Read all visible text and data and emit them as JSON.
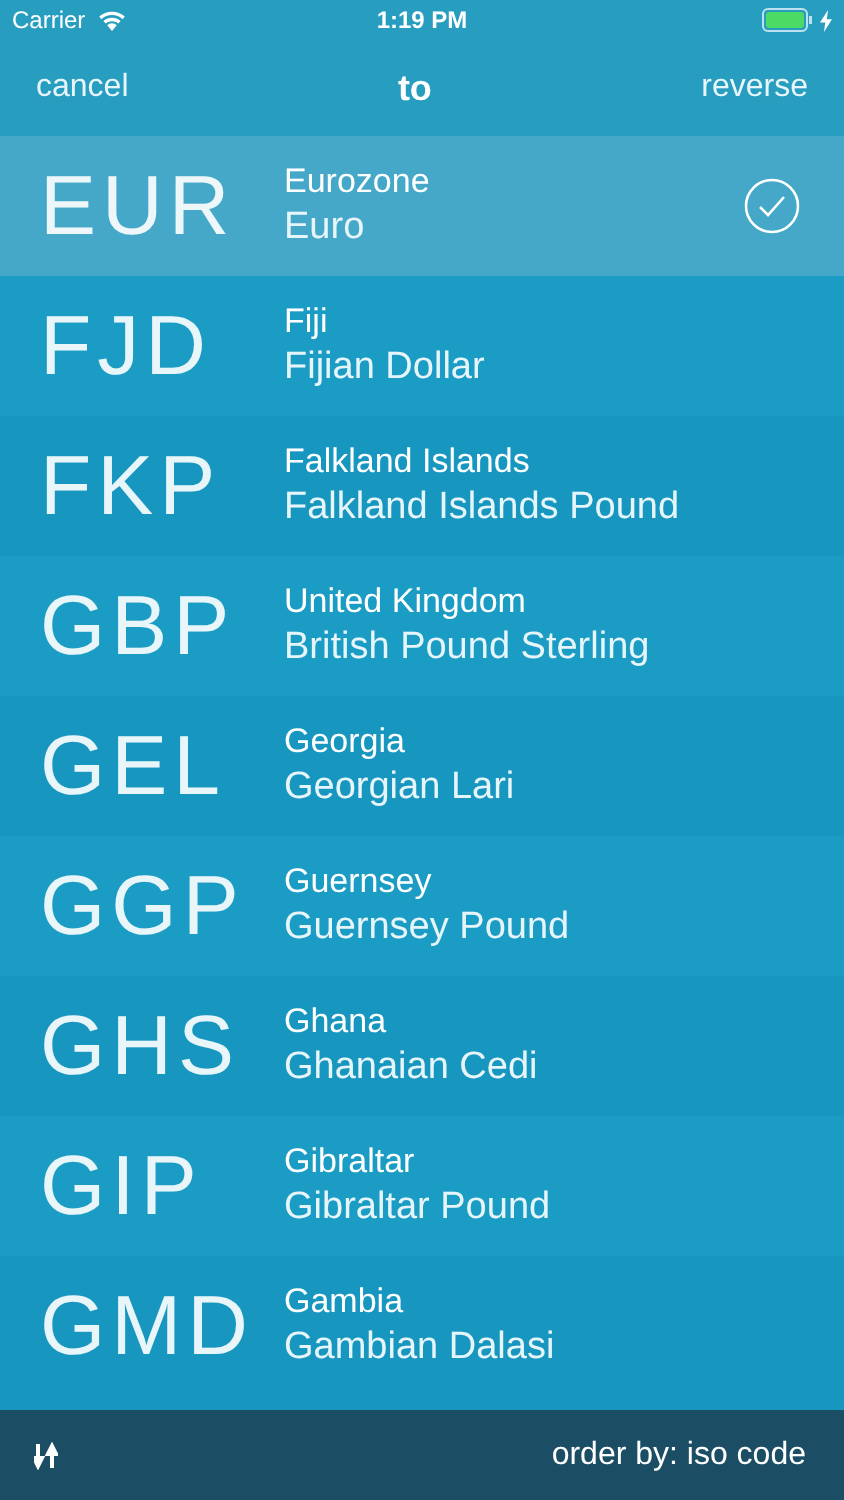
{
  "status_bar": {
    "carrier": "Carrier",
    "time": "1:19 PM"
  },
  "nav": {
    "left": "cancel",
    "title": "to",
    "right": "reverse"
  },
  "currencies": [
    {
      "code": "EUR",
      "country": "Eurozone",
      "currency": "Euro",
      "selected": true
    },
    {
      "code": "FJD",
      "country": "Fiji",
      "currency": "Fijian Dollar",
      "selected": false
    },
    {
      "code": "FKP",
      "country": "Falkland Islands",
      "currency": "Falkland Islands Pound",
      "selected": false
    },
    {
      "code": "GBP",
      "country": "United Kingdom",
      "currency": "British Pound Sterling",
      "selected": false
    },
    {
      "code": "GEL",
      "country": "Georgia",
      "currency": "Georgian Lari",
      "selected": false
    },
    {
      "code": "GGP",
      "country": "Guernsey",
      "currency": "Guernsey Pound",
      "selected": false
    },
    {
      "code": "GHS",
      "country": "Ghana",
      "currency": "Ghanaian Cedi",
      "selected": false
    },
    {
      "code": "GIP",
      "country": "Gibraltar",
      "currency": "Gibraltar Pound",
      "selected": false
    },
    {
      "code": "GMD",
      "country": "Gambia",
      "currency": "Gambian Dalasi",
      "selected": false
    }
  ],
  "toolbar": {
    "order_label": "order by: iso code"
  }
}
